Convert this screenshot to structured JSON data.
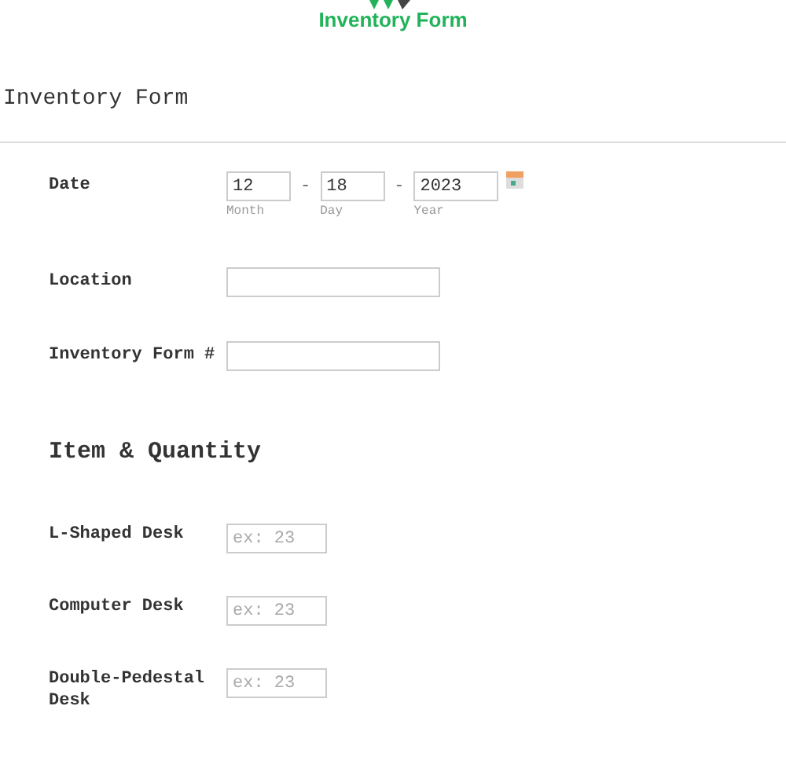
{
  "brand": {
    "name": "Inventory Form"
  },
  "form": {
    "title": "Inventory Form",
    "date": {
      "label": "Date",
      "parts": [
        {
          "value": "12",
          "caption": "Month"
        },
        {
          "value": "18",
          "caption": "Day"
        },
        {
          "value": "2023",
          "caption": "Year"
        }
      ],
      "separator": "-"
    },
    "fields": [
      {
        "label": "Location"
      },
      {
        "label": "Inventory Form #"
      }
    ],
    "section": {
      "title": "Item & Quantity"
    },
    "items": [
      {
        "label": "L-Shaped Desk",
        "placeholder": "ex: 23"
      },
      {
        "label": "Computer Desk",
        "placeholder": "ex: 23"
      },
      {
        "label": "Double-Pedestal Desk",
        "placeholder": "ex: 23"
      }
    ]
  }
}
